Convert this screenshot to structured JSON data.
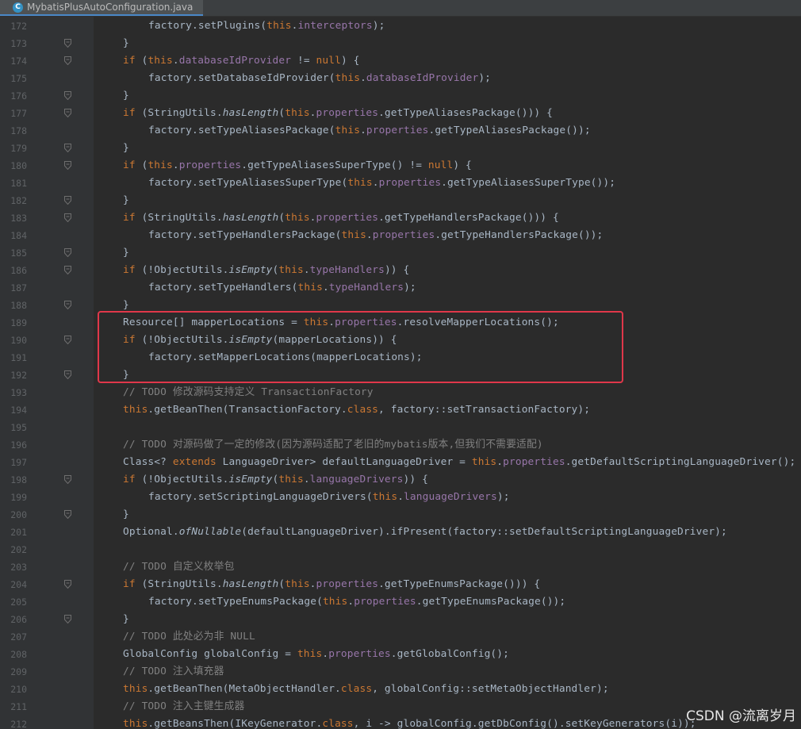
{
  "tab": {
    "icon": "C",
    "title": "MybatisPlusAutoConfiguration.java"
  },
  "watermark": "CSDN @流离岁月",
  "lines": [
    {
      "n": "172",
      "ind": 2,
      "fold": false,
      "tokens": [
        [
          "factory.setPlugins(",
          ""
        ],
        [
          "this",
          "kw"
        ],
        [
          ".",
          ""
        ],
        [
          "interceptors",
          "fld"
        ],
        [
          ");",
          ""
        ]
      ]
    },
    {
      "n": "173",
      "ind": 1,
      "fold": true,
      "tokens": [
        [
          "}",
          ""
        ]
      ]
    },
    {
      "n": "174",
      "ind": 1,
      "fold": true,
      "tokens": [
        [
          "if",
          "kw"
        ],
        [
          " (",
          ""
        ],
        [
          "this",
          "kw"
        ],
        [
          ".",
          ""
        ],
        [
          "databaseIdProvider",
          "fld"
        ],
        [
          " != ",
          ""
        ],
        [
          "null",
          "kw"
        ],
        [
          ") {",
          ""
        ]
      ]
    },
    {
      "n": "175",
      "ind": 2,
      "fold": false,
      "tokens": [
        [
          "factory.setDatabaseIdProvider(",
          ""
        ],
        [
          "this",
          "kw"
        ],
        [
          ".",
          ""
        ],
        [
          "databaseIdProvider",
          "fld"
        ],
        [
          ");",
          ""
        ]
      ]
    },
    {
      "n": "176",
      "ind": 1,
      "fold": true,
      "tokens": [
        [
          "}",
          ""
        ]
      ]
    },
    {
      "n": "177",
      "ind": 1,
      "fold": true,
      "tokens": [
        [
          "if",
          "kw"
        ],
        [
          " (StringUtils.",
          ""
        ],
        [
          "hasLength",
          "it"
        ],
        [
          "(",
          ""
        ],
        [
          "this",
          "kw"
        ],
        [
          ".",
          ""
        ],
        [
          "properties",
          "fld"
        ],
        [
          ".getTypeAliasesPackage())) {",
          ""
        ]
      ]
    },
    {
      "n": "178",
      "ind": 2,
      "fold": false,
      "tokens": [
        [
          "factory.setTypeAliasesPackage(",
          ""
        ],
        [
          "this",
          "kw"
        ],
        [
          ".",
          ""
        ],
        [
          "properties",
          "fld"
        ],
        [
          ".getTypeAliasesPackage());",
          ""
        ]
      ]
    },
    {
      "n": "179",
      "ind": 1,
      "fold": true,
      "tokens": [
        [
          "}",
          ""
        ]
      ]
    },
    {
      "n": "180",
      "ind": 1,
      "fold": true,
      "tokens": [
        [
          "if",
          "kw"
        ],
        [
          " (",
          ""
        ],
        [
          "this",
          "kw"
        ],
        [
          ".",
          ""
        ],
        [
          "properties",
          "fld"
        ],
        [
          ".getTypeAliasesSuperType() != ",
          ""
        ],
        [
          "null",
          "kw"
        ],
        [
          ") {",
          ""
        ]
      ]
    },
    {
      "n": "181",
      "ind": 2,
      "fold": false,
      "tokens": [
        [
          "factory.setTypeAliasesSuperType(",
          ""
        ],
        [
          "this",
          "kw"
        ],
        [
          ".",
          ""
        ],
        [
          "properties",
          "fld"
        ],
        [
          ".getTypeAliasesSuperType());",
          ""
        ]
      ]
    },
    {
      "n": "182",
      "ind": 1,
      "fold": true,
      "tokens": [
        [
          "}",
          ""
        ]
      ]
    },
    {
      "n": "183",
      "ind": 1,
      "fold": true,
      "tokens": [
        [
          "if",
          "kw"
        ],
        [
          " (StringUtils.",
          ""
        ],
        [
          "hasLength",
          "it"
        ],
        [
          "(",
          ""
        ],
        [
          "this",
          "kw"
        ],
        [
          ".",
          ""
        ],
        [
          "properties",
          "fld"
        ],
        [
          ".getTypeHandlersPackage())) {",
          ""
        ]
      ]
    },
    {
      "n": "184",
      "ind": 2,
      "fold": false,
      "tokens": [
        [
          "factory.setTypeHandlersPackage(",
          ""
        ],
        [
          "this",
          "kw"
        ],
        [
          ".",
          ""
        ],
        [
          "properties",
          "fld"
        ],
        [
          ".getTypeHandlersPackage());",
          ""
        ]
      ]
    },
    {
      "n": "185",
      "ind": 1,
      "fold": true,
      "tokens": [
        [
          "}",
          ""
        ]
      ]
    },
    {
      "n": "186",
      "ind": 1,
      "fold": true,
      "tokens": [
        [
          "if",
          "kw"
        ],
        [
          " (!ObjectUtils.",
          ""
        ],
        [
          "isEmpty",
          "it"
        ],
        [
          "(",
          ""
        ],
        [
          "this",
          "kw"
        ],
        [
          ".",
          ""
        ],
        [
          "typeHandlers",
          "fld"
        ],
        [
          ")) {",
          ""
        ]
      ]
    },
    {
      "n": "187",
      "ind": 2,
      "fold": false,
      "tokens": [
        [
          "factory.setTypeHandlers(",
          ""
        ],
        [
          "this",
          "kw"
        ],
        [
          ".",
          ""
        ],
        [
          "typeHandlers",
          "fld"
        ],
        [
          ");",
          ""
        ]
      ]
    },
    {
      "n": "188",
      "ind": 1,
      "fold": true,
      "tokens": [
        [
          "}",
          ""
        ]
      ]
    },
    {
      "n": "189",
      "ind": 1,
      "fold": false,
      "tokens": [
        [
          "Resource[] mapperLocations = ",
          ""
        ],
        [
          "this",
          "kw"
        ],
        [
          ".",
          ""
        ],
        [
          "properties",
          "fld"
        ],
        [
          ".resolveMapperLocations();",
          ""
        ]
      ]
    },
    {
      "n": "190",
      "ind": 1,
      "fold": true,
      "tokens": [
        [
          "if",
          "kw"
        ],
        [
          " (!ObjectUtils.",
          ""
        ],
        [
          "isEmpty",
          "it"
        ],
        [
          "(mapperLocations)) {",
          ""
        ]
      ]
    },
    {
      "n": "191",
      "ind": 2,
      "fold": false,
      "tokens": [
        [
          "factory.setMapperLocations(mapperLocations);",
          ""
        ]
      ]
    },
    {
      "n": "192",
      "ind": 1,
      "fold": true,
      "tokens": [
        [
          "}",
          ""
        ]
      ]
    },
    {
      "n": "193",
      "ind": 1,
      "fold": false,
      "tokens": [
        [
          "// TODO 修改源码支持定义 TransactionFactory",
          "cm"
        ]
      ]
    },
    {
      "n": "194",
      "ind": 1,
      "fold": false,
      "tokens": [
        [
          "this",
          "kw"
        ],
        [
          ".getBeanThen(TransactionFactory.",
          ""
        ],
        [
          "class",
          "kw"
        ],
        [
          ", factory::setTransactionFactory);",
          ""
        ]
      ]
    },
    {
      "n": "195",
      "ind": 1,
      "fold": false,
      "tokens": []
    },
    {
      "n": "196",
      "ind": 1,
      "fold": false,
      "tokens": [
        [
          "// TODO 对源码做了一定的修改(因为源码适配了老旧的mybatis版本,但我们不需要适配)",
          "cm"
        ]
      ]
    },
    {
      "n": "197",
      "ind": 1,
      "fold": false,
      "tokens": [
        [
          "Class<? ",
          ""
        ],
        [
          "extends",
          "kw"
        ],
        [
          " LanguageDriver> defaultLanguageDriver = ",
          ""
        ],
        [
          "this",
          "kw"
        ],
        [
          ".",
          ""
        ],
        [
          "properties",
          "fld"
        ],
        [
          ".getDefaultScriptingLanguageDriver();",
          ""
        ]
      ]
    },
    {
      "n": "198",
      "ind": 1,
      "fold": true,
      "tokens": [
        [
          "if",
          "kw"
        ],
        [
          " (!ObjectUtils.",
          ""
        ],
        [
          "isEmpty",
          "it"
        ],
        [
          "(",
          ""
        ],
        [
          "this",
          "kw"
        ],
        [
          ".",
          ""
        ],
        [
          "languageDrivers",
          "fld"
        ],
        [
          ")) {",
          ""
        ]
      ]
    },
    {
      "n": "199",
      "ind": 2,
      "fold": false,
      "tokens": [
        [
          "factory.setScriptingLanguageDrivers(",
          ""
        ],
        [
          "this",
          "kw"
        ],
        [
          ".",
          ""
        ],
        [
          "languageDrivers",
          "fld"
        ],
        [
          ");",
          ""
        ]
      ]
    },
    {
      "n": "200",
      "ind": 1,
      "fold": true,
      "tokens": [
        [
          "}",
          ""
        ]
      ]
    },
    {
      "n": "201",
      "ind": 1,
      "fold": false,
      "tokens": [
        [
          "Optional.",
          ""
        ],
        [
          "ofNullable",
          "it"
        ],
        [
          "(defaultLanguageDriver).ifPresent(factory::setDefaultScriptingLanguageDriver);",
          ""
        ]
      ]
    },
    {
      "n": "202",
      "ind": 1,
      "fold": false,
      "tokens": []
    },
    {
      "n": "203",
      "ind": 1,
      "fold": false,
      "tokens": [
        [
          "// TODO 自定义枚举包",
          "cm"
        ]
      ]
    },
    {
      "n": "204",
      "ind": 1,
      "fold": true,
      "tokens": [
        [
          "if",
          "kw"
        ],
        [
          " (StringUtils.",
          ""
        ],
        [
          "hasLength",
          "it"
        ],
        [
          "(",
          ""
        ],
        [
          "this",
          "kw"
        ],
        [
          ".",
          ""
        ],
        [
          "properties",
          "fld"
        ],
        [
          ".getTypeEnumsPackage())) {",
          ""
        ]
      ]
    },
    {
      "n": "205",
      "ind": 2,
      "fold": false,
      "tokens": [
        [
          "factory.setTypeEnumsPackage(",
          ""
        ],
        [
          "this",
          "kw"
        ],
        [
          ".",
          ""
        ],
        [
          "properties",
          "fld"
        ],
        [
          ".getTypeEnumsPackage());",
          ""
        ]
      ]
    },
    {
      "n": "206",
      "ind": 1,
      "fold": true,
      "tokens": [
        [
          "}",
          ""
        ]
      ]
    },
    {
      "n": "207",
      "ind": 1,
      "fold": false,
      "tokens": [
        [
          "// TODO 此处必为非 NULL",
          "cm"
        ]
      ]
    },
    {
      "n": "208",
      "ind": 1,
      "fold": false,
      "tokens": [
        [
          "GlobalConfig globalConfig = ",
          ""
        ],
        [
          "this",
          "kw"
        ],
        [
          ".",
          ""
        ],
        [
          "properties",
          "fld"
        ],
        [
          ".getGlobalConfig();",
          ""
        ]
      ]
    },
    {
      "n": "209",
      "ind": 1,
      "fold": false,
      "tokens": [
        [
          "// TODO 注入填充器",
          "cm"
        ]
      ]
    },
    {
      "n": "210",
      "ind": 1,
      "fold": false,
      "tokens": [
        [
          "this",
          "kw"
        ],
        [
          ".getBeanThen(MetaObjectHandler.",
          ""
        ],
        [
          "class",
          "kw"
        ],
        [
          ", globalConfig::setMetaObjectHandler);",
          ""
        ]
      ]
    },
    {
      "n": "211",
      "ind": 1,
      "fold": false,
      "tokens": [
        [
          "// TODO 注入主键生成器",
          "cm"
        ]
      ]
    },
    {
      "n": "212",
      "ind": 1,
      "fold": false,
      "tokens": [
        [
          "this",
          "kw"
        ],
        [
          ".getBeansThen(IKeyGenerator.",
          ""
        ],
        [
          "class",
          "kw"
        ],
        [
          ", i -> globalConfig.getDbConfig().setKeyGenerators(i));",
          ""
        ]
      ]
    }
  ]
}
